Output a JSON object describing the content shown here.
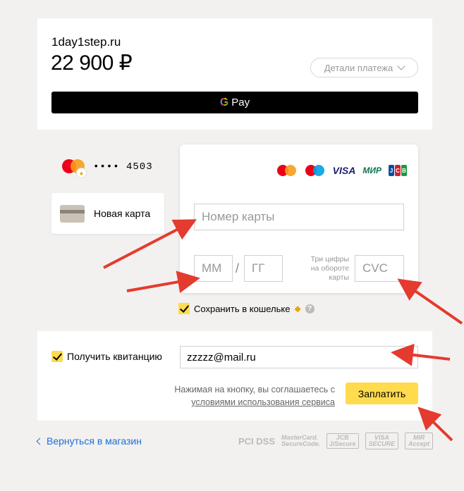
{
  "header": {
    "merchant": "1day1step.ru",
    "amount": "22 900 ₽",
    "details_label": "Детали платежа",
    "gpay_label": "Pay",
    "gpay_g": "G"
  },
  "saved_card": {
    "masked_number": "•••• 4503",
    "badge_icon": "wallet-tag-icon"
  },
  "new_card": {
    "label": "Новая карта"
  },
  "card_form": {
    "brands": [
      "mastercard",
      "maestro",
      "VISA",
      "МИР",
      "JCB"
    ],
    "visa_label": "VISA",
    "mir_label": "МИР",
    "card_number_placeholder": "Номер карты",
    "month_placeholder": "ММ",
    "year_placeholder": "ГГ",
    "separator": "/",
    "cvc_hint": "Три цифры на обороте карты",
    "cvc_placeholder": "CVC"
  },
  "save_wallet": {
    "checked": true,
    "label": "Сохранить в кошельке"
  },
  "receipt": {
    "checked": true,
    "label": "Получить квитанцию",
    "email_value": "zzzzz@mail.ru"
  },
  "agreement": {
    "text": "Нажимая на кнопку, вы соглашаетесь с",
    "link_text": "условиями использования сервиса"
  },
  "pay_button": {
    "label": "Заплатить"
  },
  "footer": {
    "back_label": "Вернуться в магазин",
    "pci": "PCI DSS",
    "mc_secure_1": "MasterCard.",
    "mc_secure_2": "SecureCode.",
    "jcb_1": "JCB",
    "jcb_2": "J/Secure",
    "visa_1": "VISA",
    "visa_2": "SECURE",
    "mir_1": "MIR",
    "mir_2": "Accept"
  },
  "colors": {
    "accent_yellow": "#ffdb4d",
    "link_blue": "#1a6fde",
    "arrow_red": "#e53a2f"
  }
}
